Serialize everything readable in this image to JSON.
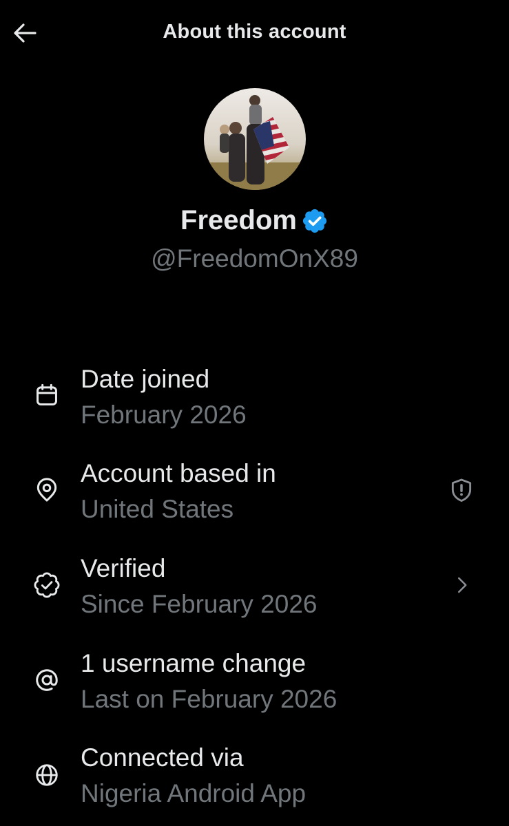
{
  "header": {
    "title": "About this account",
    "back_icon": "arrow-left-icon"
  },
  "profile": {
    "display_name": "Freedom",
    "handle": "@FreedomOnX89",
    "verified": true,
    "badge_color": "#1d9bf0"
  },
  "rows": [
    {
      "icon": "calendar-icon",
      "title": "Date joined",
      "value": "February 2026"
    },
    {
      "icon": "location-pin-icon",
      "title": "Account based in",
      "value": "United States",
      "trailing_icon": "shield-alert-icon"
    },
    {
      "icon": "verified-check-icon",
      "title": "Verified",
      "value": "Since February 2026",
      "trailing_icon": "chevron-right-icon"
    },
    {
      "icon": "at-sign-icon",
      "title": "1 username change",
      "value": "Last on February 2026"
    },
    {
      "icon": "globe-icon",
      "title": "Connected via",
      "value": "Nigeria Android App"
    }
  ],
  "colors": {
    "background": "#000000",
    "primary_text": "#e7e9ea",
    "secondary_text": "#71767b",
    "accent": "#1d9bf0"
  }
}
